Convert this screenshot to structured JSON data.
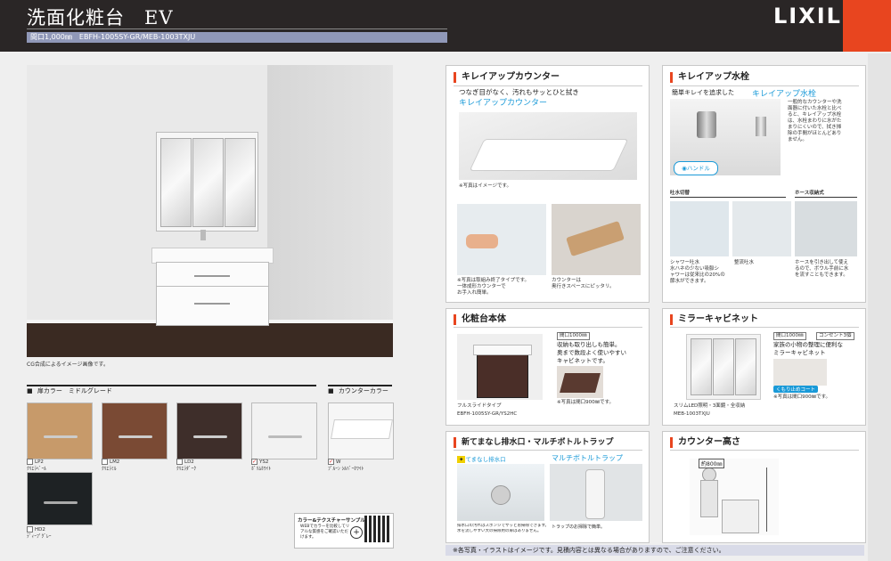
{
  "header": {
    "title": "洗面化粧台　EV",
    "subtitle": "間口1,000㎜　EBFH-1005SY-GR/MEB-1003TXJU",
    "logo": "LIXIL",
    "accent_color": "#e8451f",
    "background_color": "#2a2626"
  },
  "photo": {
    "caption": "CG合成によるイメージ画像です。"
  },
  "door_colors": {
    "heading": "扉カラー　ミドルグレード",
    "items": [
      {
        "code": "LP2",
        "name": "ｸﾘｴﾗﾍﾞｰﾙ",
        "color": "#c79a6a",
        "checked": false
      },
      {
        "code": "LM2",
        "name": "ｸﾘｴﾗﾐﾙ",
        "color": "#7a4a34",
        "checked": false
      },
      {
        "code": "LD2",
        "name": "ｸﾘｴﾗﾀﾞｰｸ",
        "color": "#3e2e2a",
        "checked": false
      },
      {
        "code": "YS2",
        "name": "ﾎﾞﾘﾑﾎﾜｲﾄ",
        "color": "#f2f2f2",
        "checked": true
      },
      {
        "code": "HD2",
        "name": "ﾃﾞｨｰﾌﾟｸﾞﾚｰ",
        "color": "#1e2224",
        "checked": false
      }
    ]
  },
  "counter_colors": {
    "heading": "カウンターカラー",
    "items": [
      {
        "code": "W",
        "name": "ﾌﾞﾙｰﾝ ｼﾙﾊﾞｰﾎﾜｲﾄ",
        "checked": true
      }
    ]
  },
  "sample": {
    "title": "カラー&テクスチャーサンプル",
    "text": "WEBでカラーを比較してリアルな質感をご確認いただけます。"
  },
  "panels": {
    "counter": {
      "title": "キレイアップカウンター",
      "lead": "つなぎ目がなく、汚れもサッとひと拭き",
      "brand": "キレイアップカウンター",
      "note": "※写真はイメージです。",
      "cap1_l1": "※写真は取組み終了タイプです。",
      "cap1_l2": "一体成形カウンターで",
      "cap1_l3": "お手入れ簡単。",
      "cap2_l1": "カウンターは",
      "cap2_l2": "奥行きスペースにピッタリ。"
    },
    "faucet": {
      "title": "キレイアップ水栓",
      "lead": "簡単キレイを追求した",
      "brand": "キレイアップ水栓",
      "desc_l1": "一般的なカウンターや洗",
      "desc_l2": "面器に付いた水栓と比べ",
      "desc_l3": "ると、キレイアップ水栓",
      "desc_l4": "は、水栓まわりに水がた",
      "desc_l5": "まりにくいので、拭き掃",
      "desc_l6": "除の手間がほとんどあり",
      "desc_l7": "ません。",
      "handle": "ハンドル",
      "sub1": "吐水切替",
      "sub2": "ホース収納式",
      "cap_a_l1": "シャワー吐水",
      "cap_a_l2": "水ハネの少ない吸脈シ",
      "cap_a_l3": "ャワーは従来比の20%の",
      "cap_a_l4": "節水ができます。",
      "cap_b": "整流吐水",
      "cap_c_l1": "ホースを引き出して使え",
      "cap_c_l2": "るので、ボウル手前に水",
      "cap_c_l3": "を流すこともできます。"
    },
    "body": {
      "title": "化粧台本体",
      "spec": "間口1000㎜",
      "desc_l1": "収納も取り出しも簡単。",
      "desc_l2": "奥まで数段よく使いやすい",
      "desc_l3": "キャビネットです。",
      "type": "フルスライドタイプ",
      "model": "EBFH-1005SY-GR/YS2HC",
      "note": "※写真は間口900㎜です。"
    },
    "mirror": {
      "title": "ミラーキャビネット",
      "spec": "間口1000㎜",
      "outlet": "コンセント3個",
      "desc_l1": "家族の小物の整理に便利な",
      "desc_l2": "ミラーキャビネット",
      "badge": "くもり止めコート",
      "note": "※写真は間口900㎜です。",
      "type": "スリムLED照明・3面鏡・全収納",
      "model": "MEB-1003TXJU"
    },
    "drain": {
      "title": "新てまなし排水口・マルチボトルトラップ",
      "brand1": "てまなし排水口",
      "brand2": "マルチボトルトラップ",
      "cap1_l1": "排水口の汚れはスポンジでサッとお掃除できます。",
      "cap1_l2": "水を流しやすい大の掃除用の扉はありません。",
      "cap2": "トラップのお掃除で簡単。"
    },
    "height": {
      "title": "カウンター高さ",
      "label": "約800㎜"
    }
  },
  "footer": {
    "note": "※各写真・イラストはイメージです。見積内容とは異なる場合がありますので、ご注意ください。"
  }
}
